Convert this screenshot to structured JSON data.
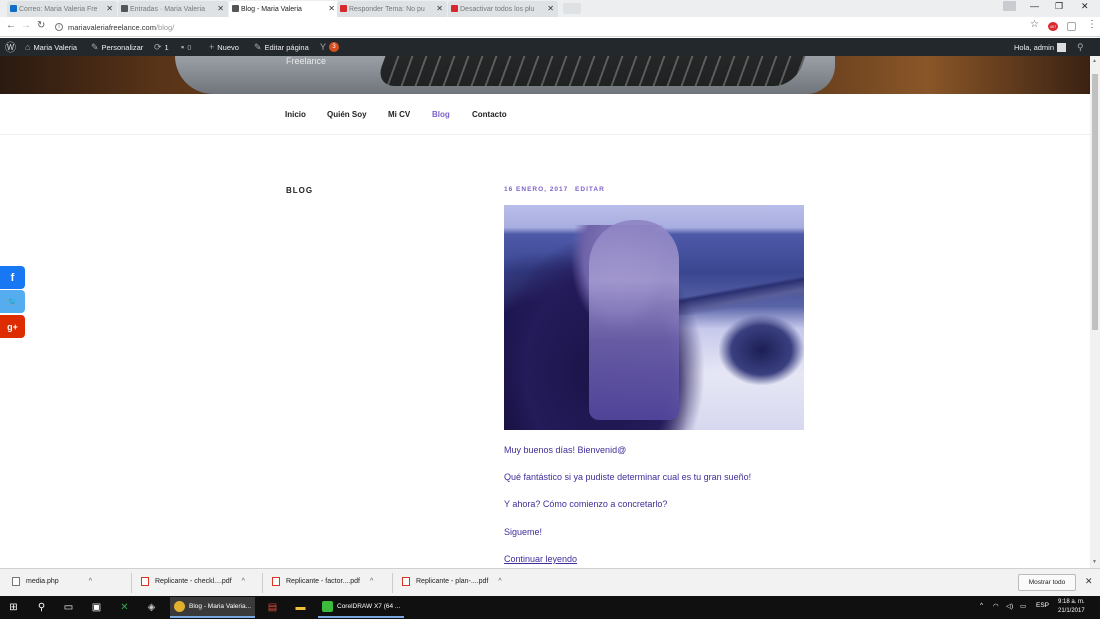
{
  "browser": {
    "tabs": [
      {
        "title": "Correo: Maria Valeria Fre",
        "state": "inactive",
        "favicon_color": "#0f6fc6"
      },
      {
        "title": "Entradas · Maria Valeria",
        "state": "inactive",
        "favicon_color": "#555555"
      },
      {
        "title": "Blog - Maria Valeria",
        "state": "active",
        "favicon_color": "#555555"
      },
      {
        "title": "Responder Tema: No pu",
        "state": "inactive",
        "favicon_color": "#d9272e"
      },
      {
        "title": "Desactivar todos los plu",
        "state": "inactive",
        "favicon_color": "#d9272e"
      }
    ],
    "url_host": "mariavaleriafreelance.com",
    "url_path": "/blog/",
    "extension_badge": "407"
  },
  "adminbar": {
    "site_name": "Maria Valeria",
    "customize": "Personalizar",
    "updates_count": "1",
    "comments_count": "0",
    "new_label": "Nuevo",
    "edit_page": "Editar página",
    "seo_notifications": "3",
    "greeting": "Hola, admin"
  },
  "site": {
    "header_subtitle": "Freelance",
    "nav": [
      {
        "label": "Inicio",
        "current": false
      },
      {
        "label": "Quién Soy",
        "current": false
      },
      {
        "label": "Mi CV",
        "current": false
      },
      {
        "label": "Blog",
        "current": true
      },
      {
        "label": "Contacto",
        "current": false
      }
    ],
    "page_heading": "BLOG",
    "post": {
      "date": "16 ENERO, 2017",
      "edit_label": "EDITAR",
      "paragraphs": [
        "Muy buenos días! Bienvenid@",
        "Qué fantástico si ya pudiste determinar cual es tu gran sueño!",
        "Y ahora? Cómo comienzo a concretarlo?",
        "Sigueme!"
      ],
      "read_more": "Continuar leyendo"
    },
    "share": [
      {
        "icon": "facebook-icon",
        "glyph": "f",
        "color": "#1877f2"
      },
      {
        "icon": "twitter-icon",
        "glyph": "🐦",
        "color": "#55acee"
      },
      {
        "icon": "google-plus-icon",
        "glyph": "g+",
        "color": "#dd2c00"
      }
    ],
    "accent_color": "#7d61c9"
  },
  "downloads": {
    "items": [
      {
        "name": "media.php",
        "type": "php"
      },
      {
        "name": "Replicante - checkl....pdf",
        "type": "pdf"
      },
      {
        "name": "Replicante - factor....pdf",
        "type": "pdf"
      },
      {
        "name": "Replicante - plan-....pdf",
        "type": "pdf"
      }
    ],
    "show_all": "Mostrar todo"
  },
  "taskbar": {
    "apps": [
      {
        "label": "Blog - Maria Valeria...",
        "state": "active",
        "color": "#e0b12c"
      },
      {
        "label": "CorelDRAW X7 (64 ...",
        "state": "open",
        "color": "#3dbb3d"
      }
    ],
    "language": "ESP",
    "time": "9:18 a. m.",
    "date": "21/1/2017"
  }
}
